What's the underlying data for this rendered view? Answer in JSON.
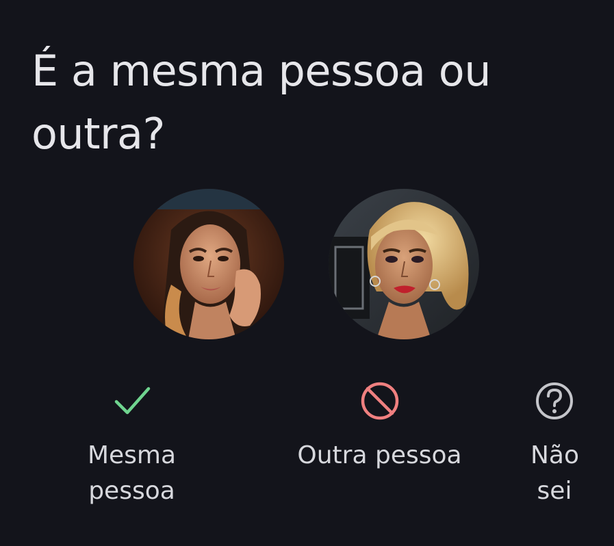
{
  "question": {
    "title": "É a mesma pessoa ou outra?"
  },
  "photos": {
    "left": {
      "description_icon": "face-photo-1"
    },
    "right": {
      "description_icon": "face-photo-2"
    }
  },
  "options": [
    {
      "label": "Mesma pessoa",
      "icon": "check-icon",
      "color": "#6fd48f"
    },
    {
      "label": "Outra pessoa",
      "icon": "prohibited-icon",
      "color": "#f08080"
    },
    {
      "label": "Não sei",
      "icon": "question-circle-icon",
      "color": "#c4c5ca"
    }
  ],
  "colors": {
    "background": "#13141b",
    "text": "#e6e6ea"
  }
}
